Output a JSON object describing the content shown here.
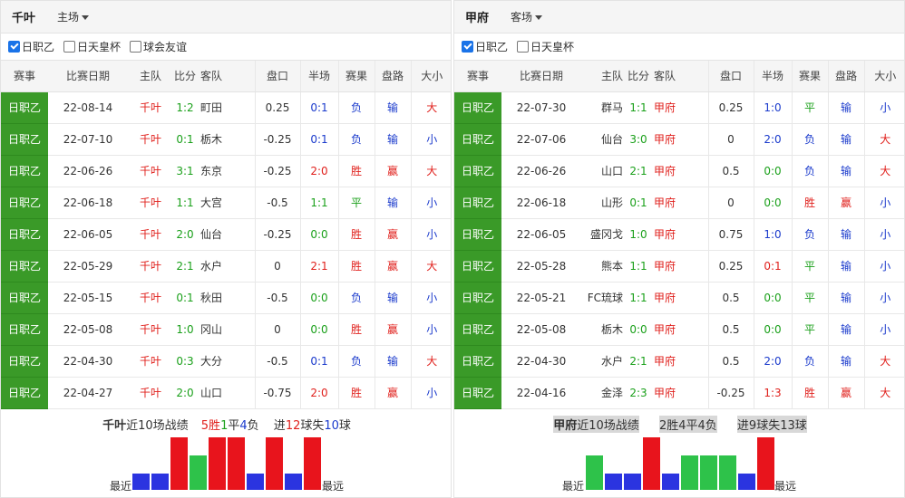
{
  "colors": {
    "win": "#e8141c",
    "draw": "#2ec24a",
    "loss": "#2b34e0",
    "league_bg": "#3a9a28"
  },
  "headers": [
    "赛事",
    "比赛日期",
    "主队",
    "比分",
    "客队",
    "盘口",
    "半场",
    "赛果",
    "盘路",
    "大小"
  ],
  "left": {
    "team": "千叶",
    "venue": "主场",
    "filters": [
      {
        "label": "日职乙",
        "checked": true
      },
      {
        "label": "日天皇杯",
        "checked": false
      },
      {
        "label": "球会友谊",
        "checked": false
      }
    ],
    "rows": [
      {
        "league": "日职乙",
        "date": "22-08-14",
        "home": "千叶",
        "score": "1:2",
        "away": "町田",
        "handicap": "0.25",
        "half": "0:1",
        "result": "负",
        "pan": "输",
        "ou": "大"
      },
      {
        "league": "日职乙",
        "date": "22-07-10",
        "home": "千叶",
        "score": "0:1",
        "away": "栃木",
        "handicap": "-0.25",
        "half": "0:1",
        "result": "负",
        "pan": "输",
        "ou": "小"
      },
      {
        "league": "日职乙",
        "date": "22-06-26",
        "home": "千叶",
        "score": "3:1",
        "away": "东京",
        "handicap": "-0.25",
        "half": "2:0",
        "result": "胜",
        "pan": "赢",
        "ou": "大"
      },
      {
        "league": "日职乙",
        "date": "22-06-18",
        "home": "千叶",
        "score": "1:1",
        "away": "大宫",
        "handicap": "-0.5",
        "half": "1:1",
        "result": "平",
        "pan": "输",
        "ou": "小"
      },
      {
        "league": "日职乙",
        "date": "22-06-05",
        "home": "千叶",
        "score": "2:0",
        "away": "仙台",
        "handicap": "-0.25",
        "half": "0:0",
        "result": "胜",
        "pan": "赢",
        "ou": "小"
      },
      {
        "league": "日职乙",
        "date": "22-05-29",
        "home": "千叶",
        "score": "2:1",
        "away": "水户",
        "handicap": "0",
        "half": "2:1",
        "result": "胜",
        "pan": "赢",
        "ou": "大"
      },
      {
        "league": "日职乙",
        "date": "22-05-15",
        "home": "千叶",
        "score": "0:1",
        "away": "秋田",
        "handicap": "-0.5",
        "half": "0:0",
        "result": "负",
        "pan": "输",
        "ou": "小"
      },
      {
        "league": "日职乙",
        "date": "22-05-08",
        "home": "千叶",
        "score": "1:0",
        "away": "冈山",
        "handicap": "0",
        "half": "0:0",
        "result": "胜",
        "pan": "赢",
        "ou": "小"
      },
      {
        "league": "日职乙",
        "date": "22-04-30",
        "home": "千叶",
        "score": "0:3",
        "away": "大分",
        "handicap": "-0.5",
        "half": "0:1",
        "result": "负",
        "pan": "输",
        "ou": "大"
      },
      {
        "league": "日职乙",
        "date": "22-04-27",
        "home": "千叶",
        "score": "2:0",
        "away": "山口",
        "handicap": "-0.75",
        "half": "2:0",
        "result": "胜",
        "pan": "赢",
        "ou": "小"
      }
    ],
    "summary": {
      "team": "千叶",
      "label": "近10场战绩",
      "win": "5",
      "win_t": "胜",
      "draw": "1",
      "draw_t": "平",
      "loss": "4",
      "loss_t": "负",
      "gf_pre": "进",
      "gf": "12",
      "gf_t": "球失",
      "ga": "10",
      "ga_t": "球"
    },
    "form": [
      "负",
      "负",
      "胜",
      "平",
      "胜",
      "胜",
      "负",
      "胜",
      "负",
      "胜"
    ],
    "recent_label": "最近",
    "far_label": "最远"
  },
  "right": {
    "team": "甲府",
    "venue": "客场",
    "filters": [
      {
        "label": "日职乙",
        "checked": true
      },
      {
        "label": "日天皇杯",
        "checked": false
      }
    ],
    "rows": [
      {
        "league": "日职乙",
        "date": "22-07-30",
        "home": "群马",
        "score": "1:1",
        "away": "甲府",
        "handicap": "0.25",
        "half": "1:0",
        "result": "平",
        "pan": "输",
        "ou": "小"
      },
      {
        "league": "日职乙",
        "date": "22-07-06",
        "home": "仙台",
        "score": "3:0",
        "away": "甲府",
        "handicap": "0",
        "half": "2:0",
        "result": "负",
        "pan": "输",
        "ou": "大"
      },
      {
        "league": "日职乙",
        "date": "22-06-26",
        "home": "山口",
        "score": "2:1",
        "away": "甲府",
        "handicap": "0.5",
        "half": "0:0",
        "result": "负",
        "pan": "输",
        "ou": "大"
      },
      {
        "league": "日职乙",
        "date": "22-06-18",
        "home": "山形",
        "score": "0:1",
        "away": "甲府",
        "handicap": "0",
        "half": "0:0",
        "result": "胜",
        "pan": "赢",
        "ou": "小"
      },
      {
        "league": "日职乙",
        "date": "22-06-05",
        "home": "盛冈戈",
        "score": "1:0",
        "away": "甲府",
        "handicap": "0.75",
        "half": "1:0",
        "result": "负",
        "pan": "输",
        "ou": "小"
      },
      {
        "league": "日职乙",
        "date": "22-05-28",
        "home": "熊本",
        "score": "1:1",
        "away": "甲府",
        "handicap": "0.25",
        "half": "0:1",
        "result": "平",
        "pan": "输",
        "ou": "小"
      },
      {
        "league": "日职乙",
        "date": "22-05-21",
        "home": "FC琉球",
        "score": "1:1",
        "away": "甲府",
        "handicap": "0.5",
        "half": "0:0",
        "result": "平",
        "pan": "输",
        "ou": "小"
      },
      {
        "league": "日职乙",
        "date": "22-05-08",
        "home": "栃木",
        "score": "0:0",
        "away": "甲府",
        "handicap": "0.5",
        "half": "0:0",
        "result": "平",
        "pan": "输",
        "ou": "小"
      },
      {
        "league": "日职乙",
        "date": "22-04-30",
        "home": "水户",
        "score": "2:1",
        "away": "甲府",
        "handicap": "0.5",
        "half": "2:0",
        "result": "负",
        "pan": "输",
        "ou": "大"
      },
      {
        "league": "日职乙",
        "date": "22-04-16",
        "home": "金泽",
        "score": "2:3",
        "away": "甲府",
        "handicap": "-0.25",
        "half": "1:3",
        "result": "胜",
        "pan": "赢",
        "ou": "大"
      }
    ],
    "summary": {
      "team": "甲府",
      "label": "近10场战绩",
      "record": "2胜4平4负",
      "goals": "进9球失13球"
    },
    "form": [
      "平",
      "负",
      "负",
      "胜",
      "负",
      "平",
      "平",
      "平",
      "负",
      "胜"
    ],
    "recent_label": "最近",
    "far_label": "最远"
  }
}
